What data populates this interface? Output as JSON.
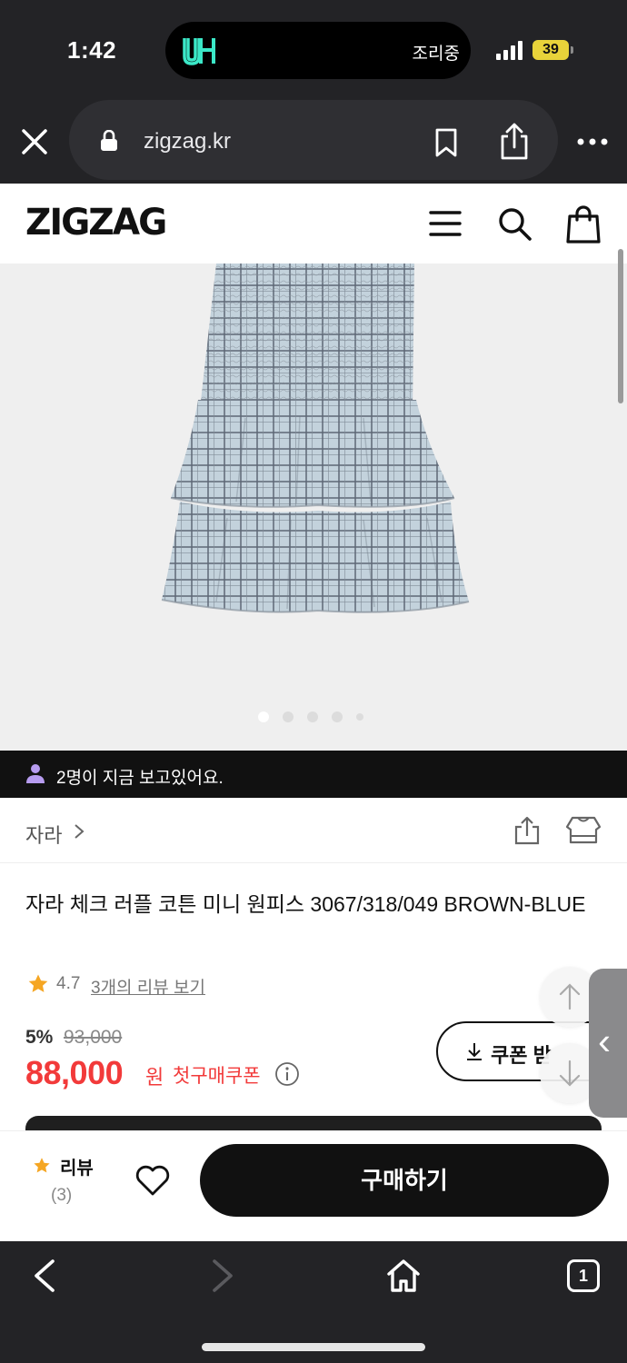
{
  "status_bar": {
    "time": "1:42",
    "island_app_label": "uh",
    "island_text": "조리중",
    "battery": "39"
  },
  "browser": {
    "url": "zigzag.kr"
  },
  "site": {
    "logo": "ZIGZAG"
  },
  "carousel": {
    "total": 5,
    "active_index": 0
  },
  "viewers": {
    "text": "2명이 지금 보고있어요."
  },
  "product": {
    "brand": "자라",
    "title": "자라 체크 러플 코튼 미니 원피스 3067/318/049 BROWN-BLUE",
    "rating": "4.7",
    "review_link": "3개의 리뷰 보기",
    "discount": "5%",
    "original_price": "93,000",
    "price": "88,000",
    "price_unit": "원",
    "coupon_label": "첫구매쿠폰",
    "coupon_button": "쿠폰 받"
  },
  "purchase_bar": {
    "review_label": "리뷰",
    "review_count": "(3)",
    "buy_label": "구매하기"
  },
  "toolbar": {
    "tab_count": "1"
  },
  "colors": {
    "price_red": "#f23a3a",
    "rating_star": "#f5a623",
    "viewer_icon": "#b79cf0",
    "dark": "#111111"
  }
}
